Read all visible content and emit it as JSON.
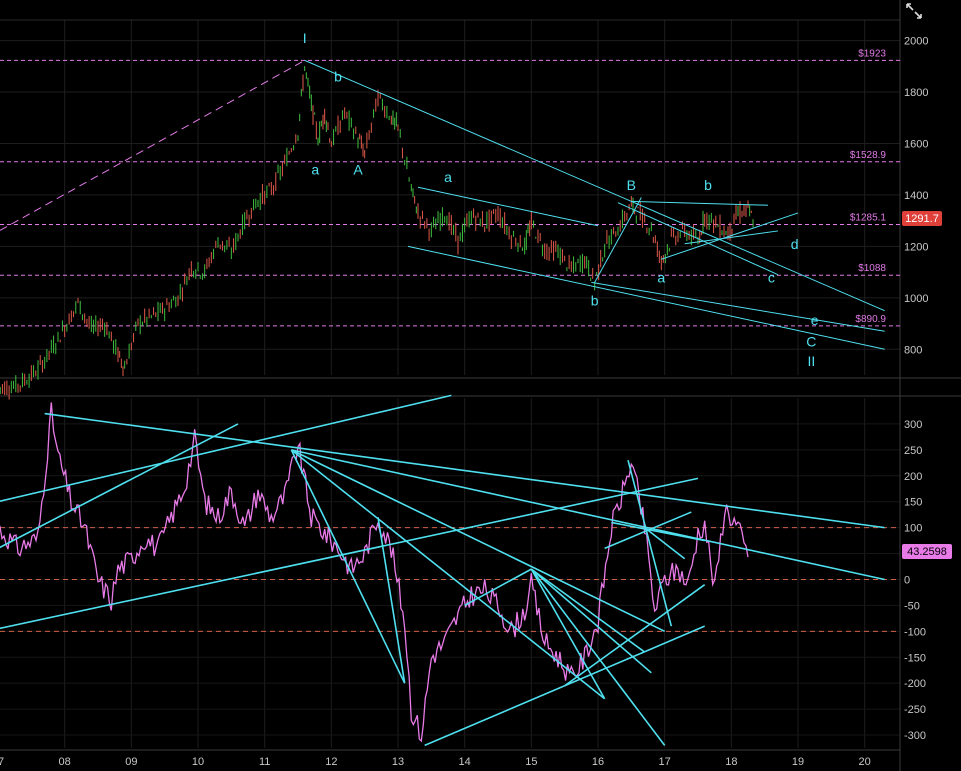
{
  "corner_icon": "collapse-arrows-icon",
  "colors": {
    "background": "#000000",
    "price_up": "#3fbf3f",
    "price_down": "#e05a4a",
    "trendline": "#4fe0ef",
    "level": "#e27be8",
    "oscillator": "#e87be8",
    "osc_ref": "#d0604a",
    "price_badge": "#e0403a",
    "osc_badge": "#e87be8"
  },
  "chart_data": [
    {
      "type": "line",
      "title": "",
      "x_axis_ticks": [
        "07",
        "08",
        "09",
        "10",
        "11",
        "12",
        "13",
        "14",
        "15",
        "16",
        "17",
        "18",
        "19",
        "20"
      ],
      "y_axis_ticks": [
        800,
        1000,
        1200,
        1400,
        1600,
        1800,
        2000
      ],
      "ylim": [
        700,
        2080
      ],
      "xlim": [
        2007.0,
        2020.5
      ],
      "last_price_badge": "1291.7",
      "horizontal_levels": [
        {
          "label": "$1923",
          "value": 1923
        },
        {
          "label": "$1528.9",
          "value": 1528.9
        },
        {
          "label": "$1285.1",
          "value": 1285.1
        },
        {
          "label": "$1088",
          "value": 1088
        },
        {
          "label": "$890.9",
          "value": 890.9
        }
      ],
      "series": [
        {
          "values": [
            [
              2007.0,
              650
            ],
            [
              2007.3,
              660
            ],
            [
              2007.6,
              720
            ],
            [
              2007.9,
              840
            ],
            [
              2008.2,
              980
            ],
            [
              2008.4,
              880
            ],
            [
              2008.6,
              900
            ],
            [
              2008.8,
              780
            ],
            [
              2008.9,
              730
            ],
            [
              2009.1,
              900
            ],
            [
              2009.4,
              940
            ],
            [
              2009.7,
              1000
            ],
            [
              2009.9,
              1120
            ],
            [
              2010.1,
              1100
            ],
            [
              2010.3,
              1220
            ],
            [
              2010.5,
              1180
            ],
            [
              2010.7,
              1300
            ],
            [
              2010.9,
              1380
            ],
            [
              2011.1,
              1420
            ],
            [
              2011.3,
              1520
            ],
            [
              2011.5,
              1650
            ],
            [
              2011.6,
              1900
            ],
            [
              2011.7,
              1750
            ],
            [
              2011.8,
              1620
            ],
            [
              2011.9,
              1720
            ],
            [
              2012.0,
              1600
            ],
            [
              2012.2,
              1720
            ],
            [
              2012.4,
              1620
            ],
            [
              2012.5,
              1560
            ],
            [
              2012.7,
              1780
            ],
            [
              2012.9,
              1700
            ],
            [
              2013.0,
              1660
            ],
            [
              2013.2,
              1420
            ],
            [
              2013.3,
              1330
            ],
            [
              2013.5,
              1260
            ],
            [
              2013.7,
              1330
            ],
            [
              2013.9,
              1220
            ],
            [
              2014.1,
              1320
            ],
            [
              2014.3,
              1290
            ],
            [
              2014.5,
              1330
            ],
            [
              2014.7,
              1240
            ],
            [
              2014.9,
              1200
            ],
            [
              2015.0,
              1290
            ],
            [
              2015.2,
              1190
            ],
            [
              2015.4,
              1180
            ],
            [
              2015.6,
              1110
            ],
            [
              2015.8,
              1150
            ],
            [
              2015.95,
              1060
            ],
            [
              2016.1,
              1200
            ],
            [
              2016.3,
              1270
            ],
            [
              2016.5,
              1360
            ],
            [
              2016.6,
              1330
            ],
            [
              2016.8,
              1270
            ],
            [
              2016.95,
              1140
            ],
            [
              2017.1,
              1230
            ],
            [
              2017.3,
              1260
            ],
            [
              2017.5,
              1220
            ],
            [
              2017.6,
              1320
            ],
            [
              2017.8,
              1280
            ],
            [
              2017.95,
              1250
            ],
            [
              2018.1,
              1330
            ],
            [
              2018.25,
              1340
            ],
            [
              2018.35,
              1291.7
            ]
          ]
        }
      ],
      "wave_labels": [
        {
          "text": "I",
          "x": 2011.6,
          "y": 1990
        },
        {
          "text": "a",
          "x": 2011.76,
          "y": 1480
        },
        {
          "text": "b",
          "x": 2012.1,
          "y": 1840
        },
        {
          "text": "A",
          "x": 2012.4,
          "y": 1480
        },
        {
          "text": "a",
          "x": 2013.75,
          "y": 1450
        },
        {
          "text": "B",
          "x": 2016.5,
          "y": 1420
        },
        {
          "text": "b",
          "x": 2017.65,
          "y": 1420
        },
        {
          "text": "d",
          "x": 2018.95,
          "y": 1190
        },
        {
          "text": "a",
          "x": 2016.95,
          "y": 1060
        },
        {
          "text": "c",
          "x": 2018.6,
          "y": 1060
        },
        {
          "text": "b",
          "x": 2015.95,
          "y": 970
        },
        {
          "text": "e",
          "x": 2019.25,
          "y": 895
        },
        {
          "text": "C",
          "x": 2019.2,
          "y": 810
        },
        {
          "text": "II",
          "x": 2019.2,
          "y": 735
        }
      ]
    },
    {
      "type": "line",
      "title": "",
      "y_axis_ticks": [
        -300,
        -250,
        -200,
        -150,
        -100,
        -50,
        0,
        50,
        100,
        150,
        200,
        250,
        300
      ],
      "ylim": [
        -325,
        350
      ],
      "reference_lines": [
        100,
        0,
        -100
      ],
      "last_value_badge": "43.2598",
      "series": [
        {
          "values": [
            [
              2007.0,
              100
            ],
            [
              2007.3,
              60
            ],
            [
              2007.6,
              80
            ],
            [
              2007.8,
              320
            ],
            [
              2007.9,
              240
            ],
            [
              2008.1,
              150
            ],
            [
              2008.3,
              100
            ],
            [
              2008.5,
              0
            ],
            [
              2008.7,
              -40
            ],
            [
              2008.8,
              20
            ],
            [
              2009.0,
              40
            ],
            [
              2009.2,
              80
            ],
            [
              2009.4,
              60
            ],
            [
              2009.6,
              120
            ],
            [
              2009.8,
              180
            ],
            [
              2009.95,
              270
            ],
            [
              2010.1,
              150
            ],
            [
              2010.3,
              120
            ],
            [
              2010.5,
              170
            ],
            [
              2010.7,
              100
            ],
            [
              2010.9,
              170
            ],
            [
              2011.1,
              120
            ],
            [
              2011.3,
              160
            ],
            [
              2011.5,
              260
            ],
            [
              2011.7,
              120
            ],
            [
              2011.9,
              90
            ],
            [
              2012.1,
              60
            ],
            [
              2012.3,
              20
            ],
            [
              2012.5,
              50
            ],
            [
              2012.7,
              120
            ],
            [
              2012.9,
              60
            ],
            [
              2013.1,
              -80
            ],
            [
              2013.2,
              -250
            ],
            [
              2013.35,
              -300
            ],
            [
              2013.5,
              -150
            ],
            [
              2013.7,
              -120
            ],
            [
              2013.9,
              -70
            ],
            [
              2014.1,
              -30
            ],
            [
              2014.3,
              -20
            ],
            [
              2014.5,
              -50
            ],
            [
              2014.7,
              -100
            ],
            [
              2014.9,
              -60
            ],
            [
              2015.0,
              -10
            ],
            [
              2015.2,
              -120
            ],
            [
              2015.4,
              -150
            ],
            [
              2015.6,
              -190
            ],
            [
              2015.8,
              -150
            ],
            [
              2016.0,
              -80
            ],
            [
              2016.2,
              100
            ],
            [
              2016.4,
              180
            ],
            [
              2016.5,
              230
            ],
            [
              2016.7,
              100
            ],
            [
              2016.85,
              -60
            ],
            [
              2017.0,
              0
            ],
            [
              2017.2,
              20
            ],
            [
              2017.35,
              -10
            ],
            [
              2017.5,
              90
            ],
            [
              2017.6,
              110
            ],
            [
              2017.75,
              -20
            ],
            [
              2017.9,
              140
            ],
            [
              2018.1,
              100
            ],
            [
              2018.25,
              43.26
            ]
          ]
        }
      ]
    }
  ]
}
